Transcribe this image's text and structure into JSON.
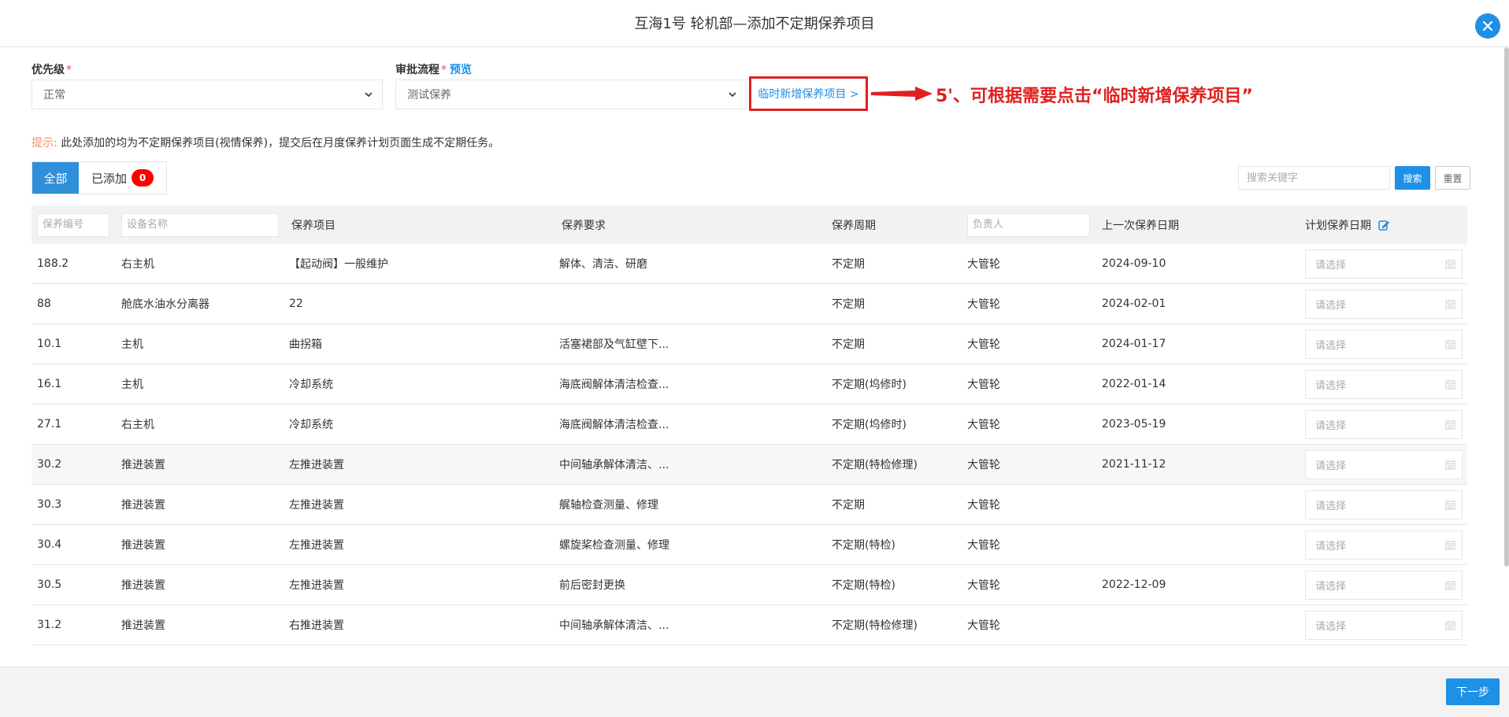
{
  "header": {
    "title": "互海1号 轮机部—添加不定期保养项目"
  },
  "form": {
    "priority_label": "优先级",
    "priority_required": "*",
    "priority_value": "正常",
    "approval_label": "审批流程",
    "approval_required": "*",
    "preview_link": "预览",
    "approval_value": "测试保养",
    "temp_add_link": "临时新增保养项目 >"
  },
  "annotation": {
    "text": "5'、可根据需要点击“临时新增保养项目”",
    "color": "#e02020"
  },
  "hint": {
    "label": "提示:",
    "text": "此处添加的均为不定期保养项目(视情保养)，提交后在月度保养计划页面生成不定期任务。"
  },
  "tabs": {
    "all": "全部",
    "added": "已添加",
    "added_count": "0"
  },
  "search": {
    "placeholder": "搜索关键字",
    "search_button": "搜索",
    "reset_button": "重置"
  },
  "table": {
    "headers": {
      "code_placeholder": "保养编号",
      "device_placeholder": "设备名称",
      "item": "保养项目",
      "requirement": "保养要求",
      "cycle": "保养周期",
      "owner_placeholder": "负责人",
      "last_date": "上一次保养日期",
      "plan_date": "计划保养日期"
    },
    "date_placeholder": "请选择",
    "rows": [
      {
        "code": "188.2",
        "device": "右主机",
        "item": "【起动阀】一般维护",
        "requirement": "解体、清洁、研磨",
        "cycle": "不定期",
        "owner": "大管轮",
        "last_date": "2024-09-10"
      },
      {
        "code": "88",
        "device": "舱底水油水分离器",
        "item": "22",
        "requirement": "",
        "cycle": "不定期",
        "owner": "大管轮",
        "last_date": "2024-02-01"
      },
      {
        "code": "10.1",
        "device": "主机",
        "item": "曲拐箱",
        "requirement": "活塞裙部及气缸壁下...",
        "cycle": "不定期",
        "owner": "大管轮",
        "last_date": "2024-01-17"
      },
      {
        "code": "16.1",
        "device": "主机",
        "item": "冷却系统",
        "requirement": "海底阀解体清洁检查...",
        "cycle": "不定期(坞修时)",
        "owner": "大管轮",
        "last_date": "2022-01-14"
      },
      {
        "code": "27.1",
        "device": "右主机",
        "item": "冷却系统",
        "requirement": "海底阀解体清洁检查...",
        "cycle": "不定期(坞修时)",
        "owner": "大管轮",
        "last_date": "2023-05-19"
      },
      {
        "code": "30.2",
        "device": "推进装置",
        "item": "左推进装置",
        "requirement": "中间轴承解体清洁、...",
        "cycle": "不定期(特检修理)",
        "owner": "大管轮",
        "last_date": "2021-11-12"
      },
      {
        "code": "30.3",
        "device": "推进装置",
        "item": "左推进装置",
        "requirement": "艉轴检查测量、修理",
        "cycle": "不定期",
        "owner": "大管轮",
        "last_date": ""
      },
      {
        "code": "30.4",
        "device": "推进装置",
        "item": "左推进装置",
        "requirement": "螺旋桨检查测量、修理",
        "cycle": "不定期(特检)",
        "owner": "大管轮",
        "last_date": ""
      },
      {
        "code": "30.5",
        "device": "推进装置",
        "item": "左推进装置",
        "requirement": "前后密封更换",
        "cycle": "不定期(特检)",
        "owner": "大管轮",
        "last_date": "2022-12-09"
      },
      {
        "code": "31.2",
        "device": "推进装置",
        "item": "右推进装置",
        "requirement": "中间轴承解体清洁、...",
        "cycle": "不定期(特检修理)",
        "owner": "大管轮",
        "last_date": ""
      }
    ]
  },
  "footer": {
    "next_button": "下一步"
  },
  "colors": {
    "primary": "#1e90e6",
    "danger": "#e02020",
    "badge": "#ff0000"
  },
  "icons": {
    "close": "close-icon",
    "chevron": "chevron-down-icon",
    "calendar": "calendar-icon",
    "edit": "edit-icon",
    "arrow": "arrow-right-icon"
  }
}
